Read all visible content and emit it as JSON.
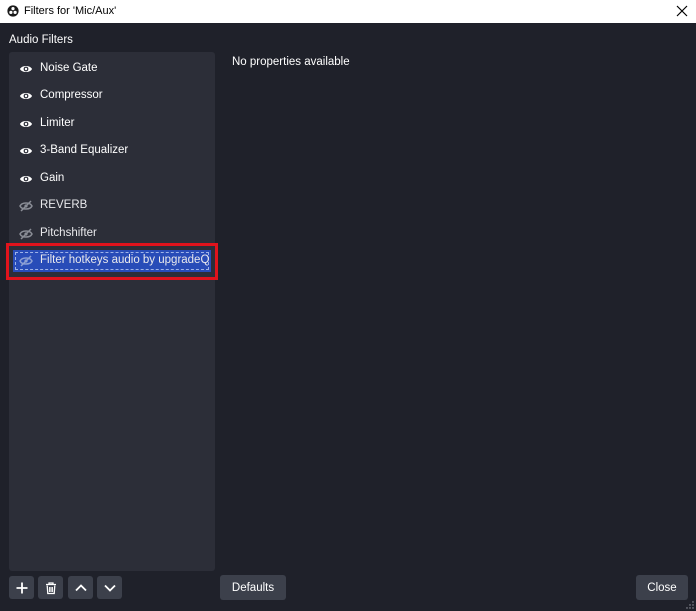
{
  "window": {
    "title": "Filters for 'Mic/Aux'"
  },
  "audio_filters": {
    "label": "Audio Filters",
    "items": [
      {
        "label": "Noise Gate",
        "enabled": true
      },
      {
        "label": "Compressor",
        "enabled": true
      },
      {
        "label": "Limiter",
        "enabled": true
      },
      {
        "label": "3-Band Equalizer",
        "enabled": true
      },
      {
        "label": "Gain",
        "enabled": true
      },
      {
        "label": "REVERB",
        "enabled": false
      },
      {
        "label": "Pitchshifter",
        "enabled": false
      },
      {
        "label": "Filter hotkeys audio by upgradeQ",
        "enabled": false,
        "selected": true
      }
    ]
  },
  "properties": {
    "empty_text": "No properties available"
  },
  "buttons": {
    "defaults_label": "Defaults",
    "close_label": "Close"
  },
  "colors": {
    "background": "#1f212a",
    "list_background": "#2c2e38",
    "button": "#3c404b",
    "selection": "#284cb8",
    "highlight": "#e0131c"
  }
}
